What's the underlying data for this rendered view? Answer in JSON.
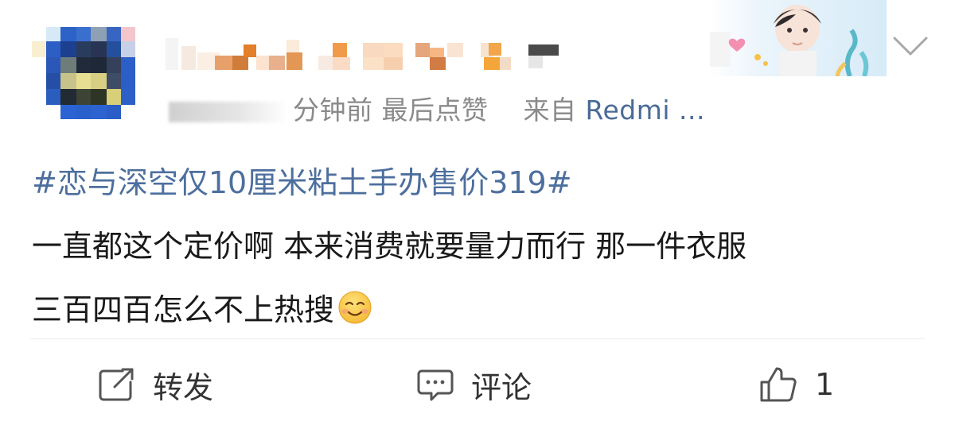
{
  "post": {
    "meta_time": "分钟前",
    "meta_last_like": "最后点赞",
    "meta_from": "来自",
    "meta_device": "Redmi ...",
    "hashtag": "#恋与深空仅10厘米粘土手办售价319#",
    "body_line1": "一直都这个定价啊 本来消费就要量力而行 那一件衣服",
    "body_line2": "三百四百怎么不上热搜",
    "emoji": "smile-emoji"
  },
  "actions": {
    "repost_label": "转发",
    "comment_label": "评论",
    "like_count": "1"
  },
  "icons": {
    "repost": "repost-icon",
    "comment": "comment-icon",
    "like": "thumbs-up-icon",
    "more": "chevron-down-icon"
  },
  "colors": {
    "link": "#4d6f9e",
    "meta": "#8a8a8a",
    "text": "#1a1a1a"
  }
}
